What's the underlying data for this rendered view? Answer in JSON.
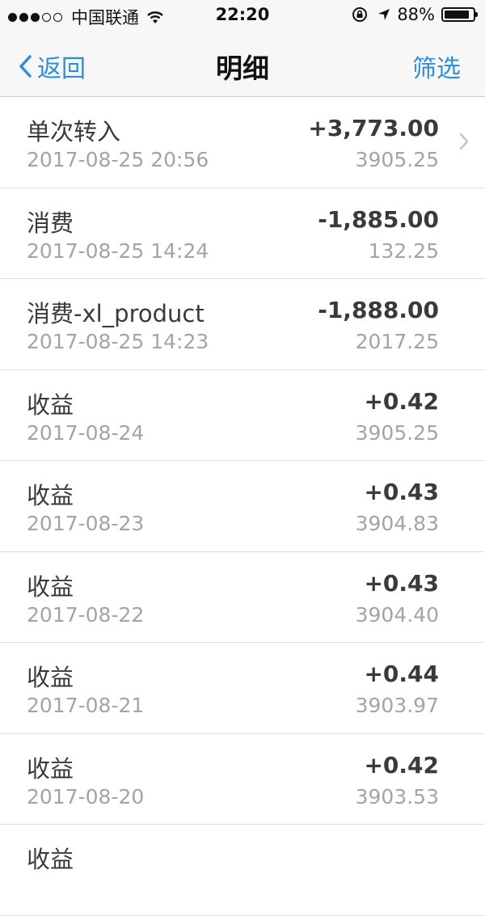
{
  "status_bar": {
    "carrier": "中国联通",
    "time": "22:20",
    "battery_percent": "88%",
    "battery_level": 0.88,
    "icons": [
      "signal-dots-icon",
      "wifi-icon",
      "orientation-lock-icon",
      "location-arrow-icon",
      "battery-icon"
    ]
  },
  "nav": {
    "back_label": "返回",
    "title": "明细",
    "filter_label": "筛选"
  },
  "colors": {
    "accent": "#2f8ed6",
    "text_primary": "#3a3a3a",
    "text_secondary": "#a4a4a8",
    "bar_bg": "#f7f7f7"
  },
  "rows": [
    {
      "title": "单次转入",
      "date": "2017-08-25 20:56",
      "amount": "+3,773.00",
      "balance": "3905.25",
      "chevron": true
    },
    {
      "title": "消费",
      "date": "2017-08-25 14:24",
      "amount": "-1,885.00",
      "balance": "132.25"
    },
    {
      "title": "消费-xl_product",
      "date": "2017-08-25 14:23",
      "amount": "-1,888.00",
      "balance": "2017.25"
    },
    {
      "title": "收益",
      "date": "2017-08-24",
      "amount": "+0.42",
      "balance": "3905.25"
    },
    {
      "title": "收益",
      "date": "2017-08-23",
      "amount": "+0.43",
      "balance": "3904.83"
    },
    {
      "title": "收益",
      "date": "2017-08-22",
      "amount": "+0.43",
      "balance": "3904.40"
    },
    {
      "title": "收益",
      "date": "2017-08-21",
      "amount": "+0.44",
      "balance": "3903.97"
    },
    {
      "title": "收益",
      "date": "2017-08-20",
      "amount": "+0.42",
      "balance": "3903.53"
    },
    {
      "title": "收益",
      "date": "",
      "amount": "",
      "balance": ""
    }
  ]
}
